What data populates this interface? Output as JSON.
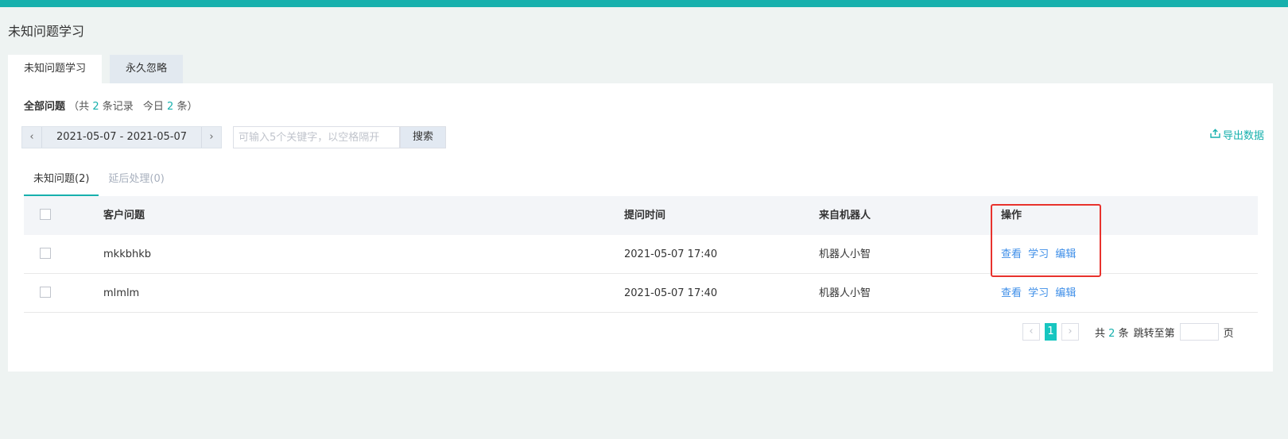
{
  "header": {
    "title": "未知问题学习"
  },
  "tabs": [
    {
      "label": "未知问题学习"
    },
    {
      "label": "永久忽略"
    }
  ],
  "summary": {
    "label": "全部问题",
    "prefix": "（共",
    "total": "2",
    "total_unit": "条记录",
    "today_label": "今日",
    "today": "2",
    "today_unit": "条）"
  },
  "date_filter": {
    "prev": "‹",
    "range": "2021-05-07 - 2021-05-07",
    "next": "›"
  },
  "search": {
    "placeholder": "可输入5个关键字，以空格隔开",
    "value": "",
    "button": "搜索"
  },
  "export": {
    "label": "导出数据",
    "icon": "export-icon"
  },
  "subtabs": [
    {
      "label": "未知问题(2)"
    },
    {
      "label": "延后处理(0)"
    }
  ],
  "table": {
    "headers": {
      "question": "客户问题",
      "time": "提问时间",
      "bot": "来自机器人",
      "ops": "操作"
    },
    "rows": [
      {
        "question": "mkkbhkb",
        "time": "2021-05-07 17:40",
        "bot": "机器人小智"
      },
      {
        "question": "mlmlm",
        "time": "2021-05-07 17:40",
        "bot": "机器人小智"
      }
    ],
    "actions": {
      "view": "查看",
      "learn": "学习",
      "edit": "编辑"
    }
  },
  "pagination": {
    "prev": "‹",
    "current": "1",
    "next": "›",
    "total_prefix": "共",
    "total": "2",
    "total_unit": "条",
    "jump_label": "跳转至第",
    "page_unit": "页"
  },
  "colors": {
    "accent": "#17b0ad",
    "link": "#3d8ee8",
    "highlight": "#e8322d"
  }
}
